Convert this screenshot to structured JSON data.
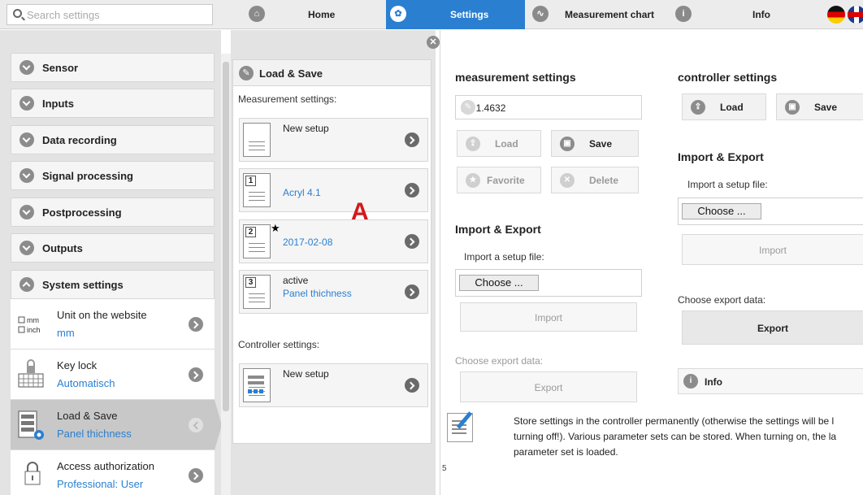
{
  "search": {
    "placeholder": "Search settings"
  },
  "nav": {
    "home": "Home",
    "settings": "Settings",
    "chart": "Measurement chart",
    "info": "Info"
  },
  "categories": [
    {
      "label": "Sensor",
      "state": "collapsed"
    },
    {
      "label": "Inputs",
      "state": "collapsed"
    },
    {
      "label": "Data recording",
      "state": "collapsed"
    },
    {
      "label": "Signal processing",
      "state": "collapsed"
    },
    {
      "label": "Postprocessing",
      "state": "collapsed"
    },
    {
      "label": "Outputs",
      "state": "collapsed"
    },
    {
      "label": "System settings",
      "state": "expanded"
    }
  ],
  "system_items": [
    {
      "title": "Unit on the website",
      "value": "mm",
      "icon": "unit-mm-inch-icon",
      "unit_options": [
        "mm",
        "inch"
      ]
    },
    {
      "title": "Key lock",
      "value": "Automatisch",
      "icon": "key-lock-icon"
    },
    {
      "title": "Load & Save",
      "value": "Panel thichness",
      "icon": "load-save-icon",
      "active": true
    },
    {
      "title": "Access authorization",
      "value": "Professional: User",
      "icon": "padlock-icon"
    }
  ],
  "middle": {
    "title": "Load & Save",
    "measurement_label": "Measurement settings:",
    "setups": [
      {
        "slot": "",
        "line1": "New setup",
        "line2": ""
      },
      {
        "slot": "1",
        "line1": "",
        "line2": "Acryl 4.1"
      },
      {
        "slot": "2",
        "line1": "",
        "line2": "2017-02-08",
        "star": "★"
      },
      {
        "slot": "3",
        "line1": "active",
        "line2": "Panel thichness"
      }
    ],
    "controller_label": "Controller settings:",
    "controller_setup": "New setup",
    "annotation": "A"
  },
  "measurement": {
    "title": "measurement settings",
    "input_value": "FS 1.4632",
    "load": "Load",
    "save": "Save",
    "favorite": "Favorite",
    "delete": "Delete",
    "import_export_title": "Import & Export",
    "import_label": "Import a setup file:",
    "choose": "Choose ...",
    "import_btn": "Import",
    "export_label": "Choose export data:",
    "export_btn": "Export"
  },
  "controller": {
    "title": "controller settings",
    "load": "Load",
    "save": "Save",
    "import_export_title": "Import & Export",
    "import_label": "Import a setup file:",
    "choose": "Choose ...",
    "import_btn": "Import",
    "export_label": "Choose export data:",
    "export_btn": "Export",
    "info_label": "Info"
  },
  "info_text": {
    "line1": "Store settings in the controller permanently (otherwise the settings will be l",
    "line2": "turning off!). Various parameter sets can be stored. When turning on, the la",
    "line3": "parameter set is loaded.",
    "page_number": "5"
  },
  "colors": {
    "accent": "#2a7fd0",
    "annotation": "#d21a1a"
  }
}
